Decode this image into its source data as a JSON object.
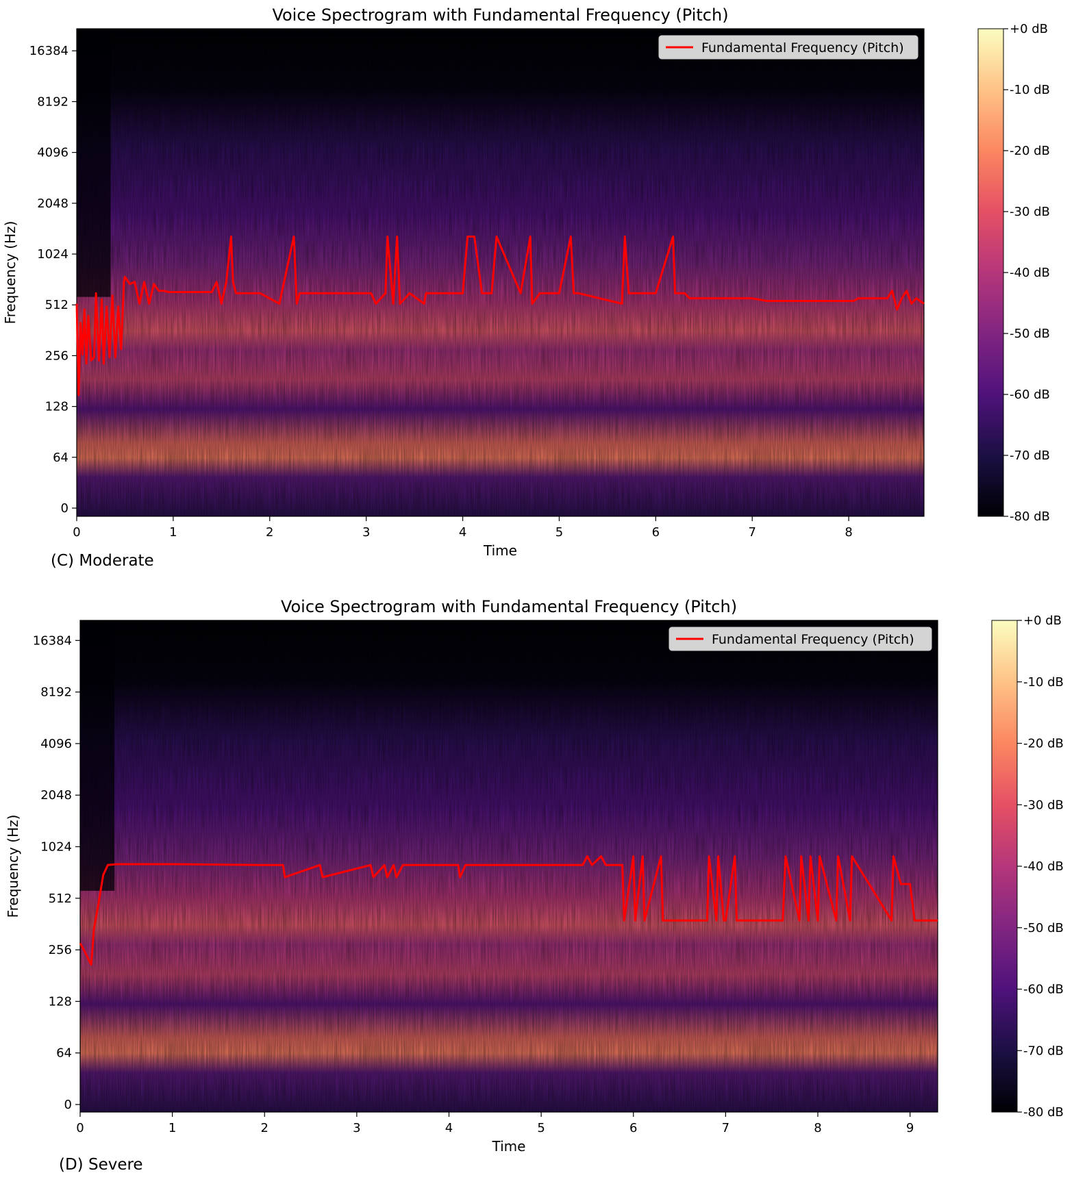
{
  "colors": {
    "pitch_line": "#ff0000",
    "colormap": [
      "#000004",
      "#1c1044",
      "#4f127b",
      "#812581",
      "#b5367a",
      "#e55064",
      "#fb8761",
      "#fec287",
      "#fcfdbf"
    ]
  },
  "chart_data": [
    {
      "type": "heatmap",
      "caption": "(C) Moderate",
      "title": "Voice Spectrogram with Fundamental Frequency (Pitch)",
      "xlabel": "Time",
      "ylabel": "Frequency (Hz)",
      "x_scale": "linear",
      "y_scale": "log2",
      "xlim": [
        0,
        8.78
      ],
      "x_ticks": [
        "0",
        "1",
        "2",
        "3",
        "4",
        "5",
        "6",
        "7",
        "8"
      ],
      "y_ticks": [
        "0",
        "64",
        "128",
        "256",
        "512",
        "1024",
        "2048",
        "4096",
        "8192",
        "16384"
      ],
      "colorbar": {
        "label_ticks": [
          "+0 dB",
          "-10 dB",
          "-20 dB",
          "-30 dB",
          "-40 dB",
          "-50 dB",
          "-60 dB",
          "-70 dB",
          "-80 dB"
        ],
        "range_db": [
          -80,
          0
        ],
        "colormap": "magma"
      },
      "legend": {
        "position": "top-right",
        "entries": [
          "Fundamental Frequency (Pitch)"
        ]
      },
      "grid": false,
      "series": [
        {
          "name": "Fundamental Frequency (Pitch)",
          "x": [
            0.0,
            0.02,
            0.04,
            0.06,
            0.08,
            0.1,
            0.12,
            0.15,
            0.18,
            0.2,
            0.23,
            0.26,
            0.28,
            0.31,
            0.34,
            0.37,
            0.4,
            0.43,
            0.46,
            0.49,
            0.5,
            0.55,
            0.6,
            0.65,
            0.7,
            0.75,
            0.8,
            0.85,
            0.9,
            0.95,
            1.0,
            1.05,
            1.1,
            1.2,
            1.4,
            1.45,
            1.5,
            1.55,
            1.6,
            1.62,
            1.65,
            1.9,
            2.1,
            2.25,
            2.28,
            2.31,
            2.4,
            2.5,
            2.9,
            3.05,
            3.1,
            3.2,
            3.22,
            3.28,
            3.32,
            3.35,
            3.45,
            3.6,
            3.62,
            4.0,
            4.05,
            4.12,
            4.2,
            4.3,
            4.35,
            4.6,
            4.7,
            4.72,
            4.8,
            5.0,
            5.12,
            5.15,
            5.2,
            5.65,
            5.68,
            5.72,
            6.0,
            6.18,
            6.2,
            6.3,
            6.35,
            6.5,
            6.7,
            7.0,
            7.15,
            7.4,
            7.8,
            7.82,
            8.05,
            8.1,
            8.2,
            8.4,
            8.45,
            8.5,
            8.55,
            8.6,
            8.65,
            8.7,
            8.78
          ],
          "y": [
            520,
            150,
            400,
            260,
            480,
            230,
            440,
            240,
            250,
            600,
            240,
            550,
            230,
            500,
            250,
            580,
            250,
            500,
            280,
            700,
            750,
            680,
            700,
            520,
            700,
            520,
            680,
            620,
            620,
            610,
            610,
            610,
            610,
            610,
            610,
            700,
            520,
            700,
            1300,
            700,
            600,
            600,
            520,
            1300,
            520,
            600,
            600,
            600,
            600,
            600,
            520,
            600,
            1300,
            520,
            1300,
            520,
            600,
            520,
            600,
            600,
            1300,
            1300,
            600,
            600,
            1300,
            600,
            1300,
            520,
            600,
            600,
            1300,
            600,
            600,
            520,
            1300,
            600,
            600,
            1300,
            600,
            600,
            560,
            560,
            560,
            560,
            540,
            540,
            540,
            540,
            540,
            560,
            560,
            560,
            620,
            480,
            560,
            620,
            520,
            560,
            520
          ]
        }
      ]
    },
    {
      "type": "heatmap",
      "caption": "(D) Severe",
      "title": "Voice Spectrogram with Fundamental Frequency (Pitch)",
      "xlabel": "Time",
      "ylabel": "Frequency (Hz)",
      "x_scale": "linear",
      "y_scale": "log2",
      "xlim": [
        0,
        9.3
      ],
      "x_ticks": [
        "0",
        "1",
        "2",
        "3",
        "4",
        "5",
        "6",
        "7",
        "8",
        "9"
      ],
      "y_ticks": [
        "0",
        "64",
        "128",
        "256",
        "512",
        "1024",
        "2048",
        "4096",
        "8192",
        "16384"
      ],
      "colorbar": {
        "label_ticks": [
          "+0 dB",
          "-10 dB",
          "-20 dB",
          "-30 dB",
          "-40 dB",
          "-50 dB",
          "-60 dB",
          "-70 dB",
          "-80 dB"
        ],
        "range_db": [
          -80,
          0
        ],
        "colormap": "magma"
      },
      "legend": {
        "position": "top-right",
        "entries": [
          "Fundamental Frequency (Pitch)"
        ]
      },
      "grid": false,
      "series": [
        {
          "name": "Fundamental Frequency (Pitch)",
          "x": [
            0.0,
            0.05,
            0.1,
            0.12,
            0.15,
            0.2,
            0.25,
            0.3,
            0.4,
            1.0,
            2.0,
            2.2,
            2.22,
            2.6,
            2.63,
            3.15,
            3.18,
            3.3,
            3.33,
            3.4,
            3.43,
            3.5,
            4.1,
            4.12,
            4.18,
            4.2,
            5.0,
            5.45,
            5.5,
            5.55,
            5.65,
            5.7,
            5.88,
            5.9,
            6.0,
            6.02,
            6.1,
            6.12,
            6.3,
            6.32,
            6.8,
            6.82,
            6.9,
            6.92,
            6.98,
            7.0,
            7.1,
            7.12,
            7.4,
            7.5,
            7.62,
            7.65,
            7.8,
            7.82,
            7.9,
            7.92,
            8.0,
            8.02,
            8.2,
            8.22,
            8.35,
            8.37,
            8.8,
            8.82,
            8.9,
            9.0,
            9.05,
            9.3
          ],
          "y": [
            280,
            250,
            220,
            210,
            340,
            480,
            700,
            800,
            810,
            810,
            800,
            800,
            680,
            800,
            680,
            800,
            680,
            800,
            680,
            800,
            680,
            800,
            800,
            680,
            800,
            800,
            800,
            800,
            900,
            800,
            900,
            800,
            800,
            380,
            900,
            380,
            900,
            380,
            900,
            380,
            380,
            900,
            380,
            900,
            380,
            380,
            900,
            380,
            380,
            380,
            380,
            900,
            380,
            900,
            380,
            900,
            380,
            900,
            380,
            900,
            380,
            900,
            380,
            900,
            620,
            620,
            380,
            380
          ]
        }
      ]
    }
  ]
}
